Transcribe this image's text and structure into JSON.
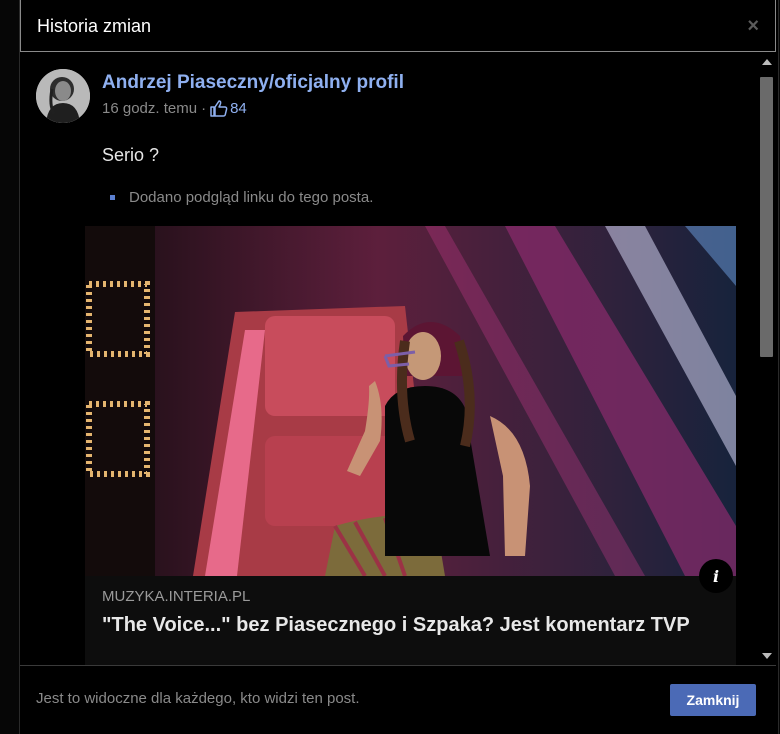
{
  "dialog": {
    "title": "Historia zmian",
    "close_icon": "×"
  },
  "post": {
    "author": "Andrzej Piaseczny/oficjalny profil",
    "timestamp": "16 godz. temu",
    "separator": "·",
    "like_icon": "thumbs-up-icon",
    "like_count": "84",
    "text": "Serio ?",
    "changes": [
      "Dodano podgląd linku do tego posta."
    ]
  },
  "link_preview": {
    "info_icon": "i",
    "domain": "MUZYKA.INTERIA.PL",
    "title": "\"The Voice...\" bez Piasecznego i Szpaka? Jest komentarz TVP"
  },
  "footer": {
    "note": "Jest to widoczne dla każdego, kto widzi ten post.",
    "close_label": "Zamknij"
  },
  "colors": {
    "accent": "#4b6ab6",
    "link_text": "#8fb0f0"
  }
}
